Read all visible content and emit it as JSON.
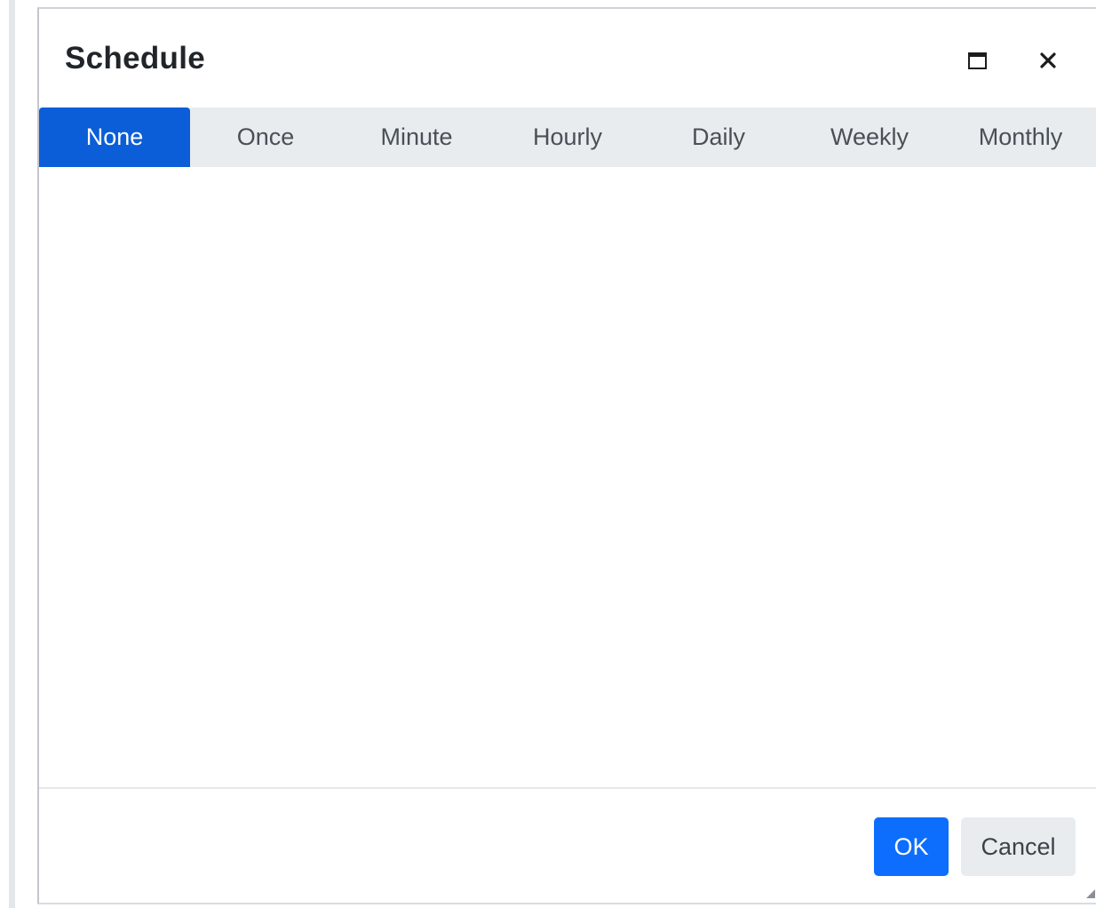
{
  "dialog": {
    "title": "Schedule",
    "maximize_icon": "maximize-icon",
    "close_icon": "close-icon",
    "close_glyph": "✕"
  },
  "tabs": [
    {
      "label": "None",
      "active": true
    },
    {
      "label": "Once",
      "active": false
    },
    {
      "label": "Minute",
      "active": false
    },
    {
      "label": "Hourly",
      "active": false
    },
    {
      "label": "Daily",
      "active": false
    },
    {
      "label": "Weekly",
      "active": false
    },
    {
      "label": "Monthly",
      "active": false
    }
  ],
  "footer": {
    "ok_label": "OK",
    "cancel_label": "Cancel"
  },
  "colors": {
    "accent": "#0b5ed7",
    "primary_button": "#0d6efd",
    "tab_bar": "#e9ecef",
    "secondary_button": "#e9ecef"
  }
}
